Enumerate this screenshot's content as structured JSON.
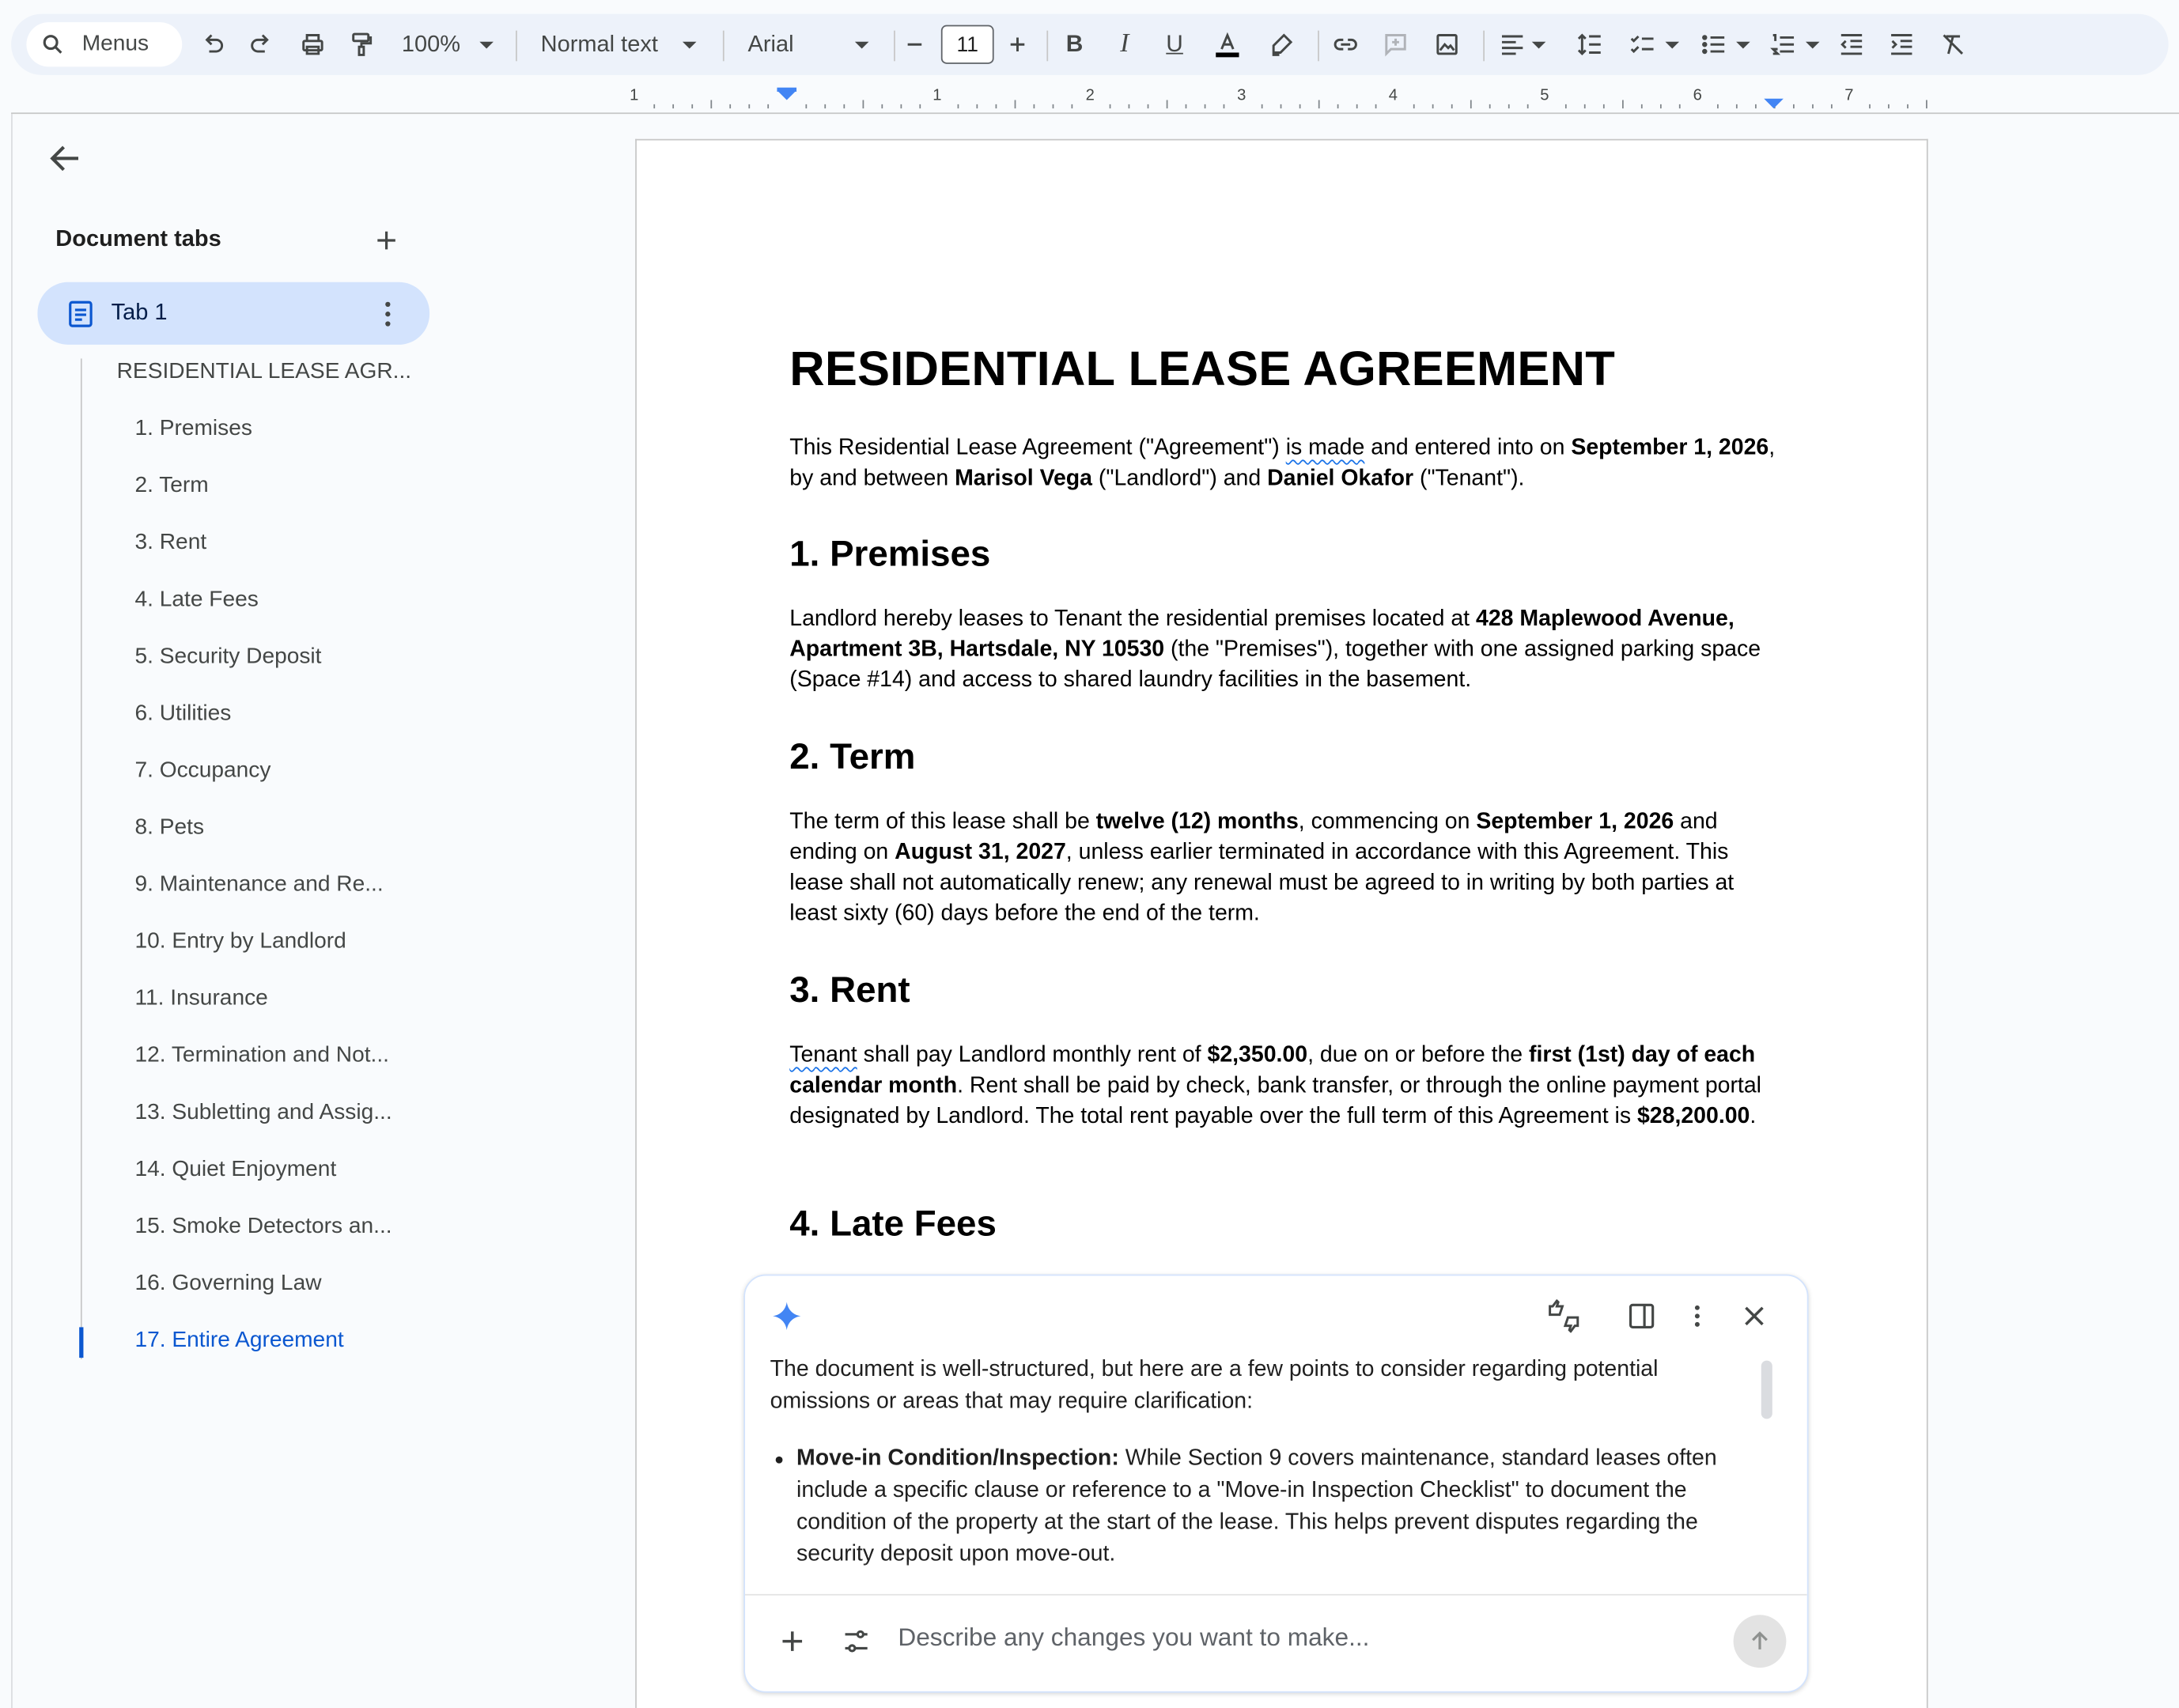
{
  "toolbar": {
    "search_label": "Menus",
    "zoom": "100%",
    "style": "Normal text",
    "font": "Arial",
    "font_size": "11"
  },
  "ruler": {
    "numbers": [
      "1",
      "1",
      "2",
      "3",
      "4",
      "5",
      "6",
      "7"
    ]
  },
  "sidebar": {
    "title": "Document tabs",
    "tab_label": "Tab 1",
    "outline": [
      "RESIDENTIAL LEASE AGR...",
      "1. Premises",
      "2. Term",
      "3. Rent",
      "4. Late Fees",
      "5. Security Deposit",
      "6. Utilities",
      "7. Occupancy",
      "8. Pets",
      "9. Maintenance and Re...",
      "10. Entry by Landlord",
      "11. Insurance",
      "12. Termination and Not...",
      "13. Subletting and Assig...",
      "14. Quiet Enjoyment",
      "15. Smoke Detectors an...",
      "16. Governing Law",
      "17. Entire Agreement"
    ]
  },
  "document": {
    "title": "RESIDENTIAL LEASE AGREEMENT",
    "intro": {
      "t1": "This Residential Lease Agreement (\"Agreement\") ",
      "t2": "is made",
      "t3": " and entered into on ",
      "date": "September 1, 2026",
      "t4": ", by and between ",
      "landlord": "Marisol Vega",
      "t5": " (\"Landlord\") and ",
      "tenant": "Daniel Okafor",
      "t6": " (\"Tenant\")."
    },
    "s1": {
      "heading": "1. Premises",
      "t1": "Landlord hereby leases to Tenant the residential premises located at ",
      "address": "428 Maplewood Avenue, Apartment 3B, Hartsdale, NY 10530",
      "t2": " (the \"Premises\"), together with one assigned parking space (Space #14) and access to shared laundry facilities in the basement."
    },
    "s2": {
      "heading": "2. Term",
      "t1": "The term of this lease shall be ",
      "duration": "twelve (12) months",
      "t2": ", commencing on ",
      "start": "September 1, 2026",
      "t3": " and ending on ",
      "end": "August 31, 2027",
      "t4": ", unless earlier terminated in accordance with this Agreement. This lease shall not automatically renew; any renewal must be agreed to in writing by both parties at least sixty (60) days before the end of the term."
    },
    "s3": {
      "heading": "3. Rent",
      "w1": "Tenant",
      "t1": " shall pay Landlord monthly rent of ",
      "rent": "$2,350.00",
      "t2": ", due on or before the ",
      "due": "first (1st) day of each calendar month",
      "t3": ". Rent shall be paid by check, bank transfer, or through the online payment portal designated by Landlord. The total rent payable over the full term of this Agreement is ",
      "total": "$28,200.00",
      "t4": "."
    },
    "s4": {
      "heading": "4. Late Fees"
    }
  },
  "gemini": {
    "intro": "The document is well-structured, but here are a few points to consider regarding potential omissions or areas that may require clarification:",
    "bullet_title": "Move-in Condition/Inspection:",
    "bullet_text": " While Section 9 covers maintenance, standard leases often include a specific clause or reference to a \"Move-in Inspection Checklist\" to document the condition of the property at the start of the lease. This helps prevent disputes regarding the security deposit upon move-out.",
    "input_placeholder": "Describe any changes you want to make..."
  },
  "colors": {
    "accent": "#0b57d0",
    "tab_bg": "#d3e3fd",
    "toolbar_bg": "#edf2fa"
  }
}
